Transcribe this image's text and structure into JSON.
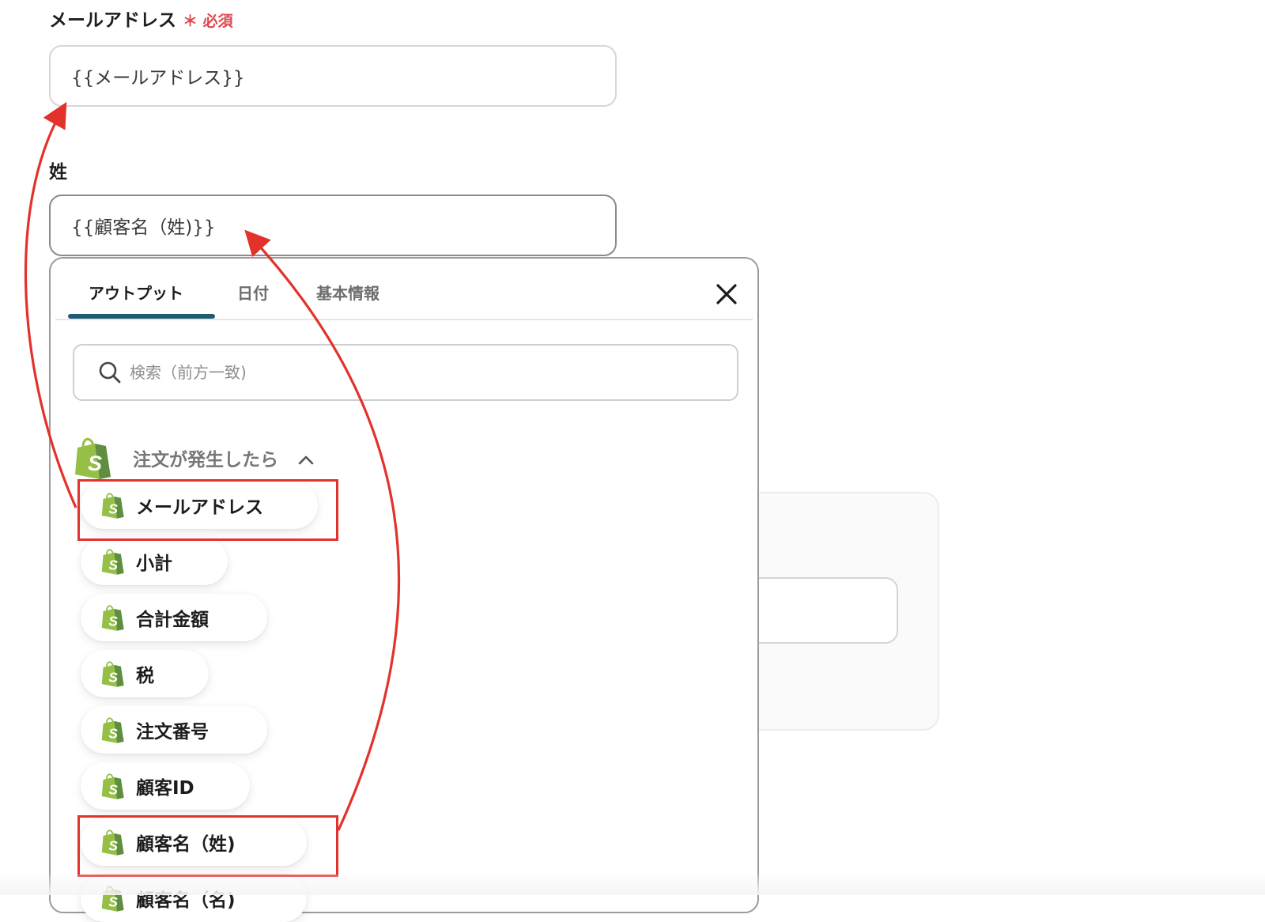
{
  "form": {
    "email": {
      "label": "メールアドレス",
      "required_mark": "＊ 必須",
      "value": "{{メールアドレス}}"
    },
    "last_name": {
      "label": "姓",
      "value": "{{顧客名（姓)}}"
    }
  },
  "panel": {
    "tabs": [
      {
        "label": "アウトプット",
        "active": true
      },
      {
        "label": "日付",
        "active": false
      },
      {
        "label": "基本情報",
        "active": false
      }
    ],
    "search": {
      "placeholder": "検索（前方一致)"
    },
    "group": {
      "title": "注文が発生したら",
      "icon": "shopify-bag-icon",
      "expanded": true
    },
    "items": [
      {
        "label": "メールアドレス",
        "highlighted": true
      },
      {
        "label": "小計",
        "highlighted": false
      },
      {
        "label": "合計金額",
        "highlighted": false
      },
      {
        "label": "税",
        "highlighted": false
      },
      {
        "label": "注文番号",
        "highlighted": false
      },
      {
        "label": "顧客ID",
        "highlighted": false
      },
      {
        "label": "顧客名（姓)",
        "highlighted": true
      },
      {
        "label": "顧客名（名)",
        "highlighted": false
      }
    ]
  },
  "colors": {
    "accent_tab": "#1f5c73",
    "annotation_red": "#e2322b",
    "required_red": "#e0474c",
    "shopify_green_light": "#95bf47",
    "shopify_green_dark": "#5e8e3e"
  }
}
